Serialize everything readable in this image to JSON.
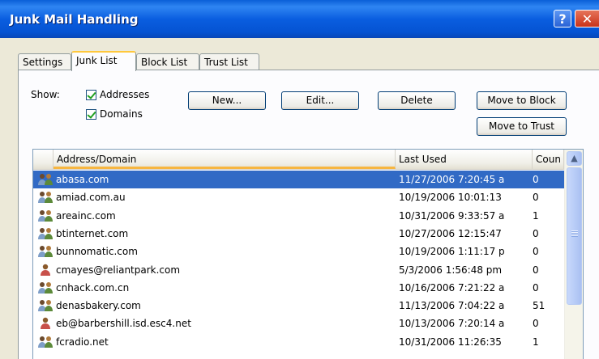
{
  "window": {
    "title": "Junk Mail Handling",
    "help_glyph": "?",
    "close_glyph": "✕"
  },
  "tabs": [
    {
      "label": "Settings",
      "active": false
    },
    {
      "label": "Junk List",
      "active": true
    },
    {
      "label": "Block List",
      "active": false
    },
    {
      "label": "Trust List",
      "active": false
    }
  ],
  "show": {
    "label": "Show:",
    "options": [
      {
        "label": "Addresses",
        "checked": true
      },
      {
        "label": "Domains",
        "checked": true
      }
    ]
  },
  "buttons": {
    "new": "New...",
    "edit": "Edit...",
    "delete": "Delete",
    "move_to_block": "Move to Block",
    "move_to_trust": "Move to Trust"
  },
  "list": {
    "columns": [
      "Address/Domain",
      "Last Used",
      "Coun"
    ],
    "sorted_column": "Address/Domain",
    "rows": [
      {
        "address": "abasa.com",
        "last_used": "11/27/2006 7:20:45 a",
        "count": "0",
        "icon": "group-icon",
        "selected": true
      },
      {
        "address": "amiad.com.au",
        "last_used": "10/19/2006 10:01:13",
        "count": "0",
        "icon": "group-icon",
        "selected": false
      },
      {
        "address": "areainc.com",
        "last_used": "10/31/2006 9:33:57 a",
        "count": "1",
        "icon": "group-icon",
        "selected": false
      },
      {
        "address": "btinternet.com",
        "last_used": "10/27/2006 12:15:47",
        "count": "0",
        "icon": "group-icon",
        "selected": false
      },
      {
        "address": "bunnomatic.com",
        "last_used": "10/19/2006 1:11:17 p",
        "count": "0",
        "icon": "group-icon",
        "selected": false
      },
      {
        "address": "cmayes@reliantpark.com",
        "last_used": "5/3/2006 1:56:48 pm",
        "count": "0",
        "icon": "person-icon",
        "selected": false
      },
      {
        "address": "cnhack.com.cn",
        "last_used": "10/16/2006 7:21:22 a",
        "count": "0",
        "icon": "group-icon",
        "selected": false
      },
      {
        "address": "denasbakery.com",
        "last_used": "11/13/2006 7:04:22 a",
        "count": "51",
        "icon": "group-icon",
        "selected": false
      },
      {
        "address": "eb@barbershill.isd.esc4.net",
        "last_used": "10/13/2006 7:20:14 a",
        "count": "0",
        "icon": "person-icon",
        "selected": false
      },
      {
        "address": "fcradio.net",
        "last_used": "10/31/2006 11:26:35",
        "count": "1",
        "icon": "group-icon",
        "selected": false
      }
    ]
  },
  "scrollbar": {
    "up_glyph": "▲"
  },
  "colors": {
    "title_bar": "#0a5ee0",
    "selection": "#316ac5",
    "tab_highlight": "#ffc83c"
  }
}
